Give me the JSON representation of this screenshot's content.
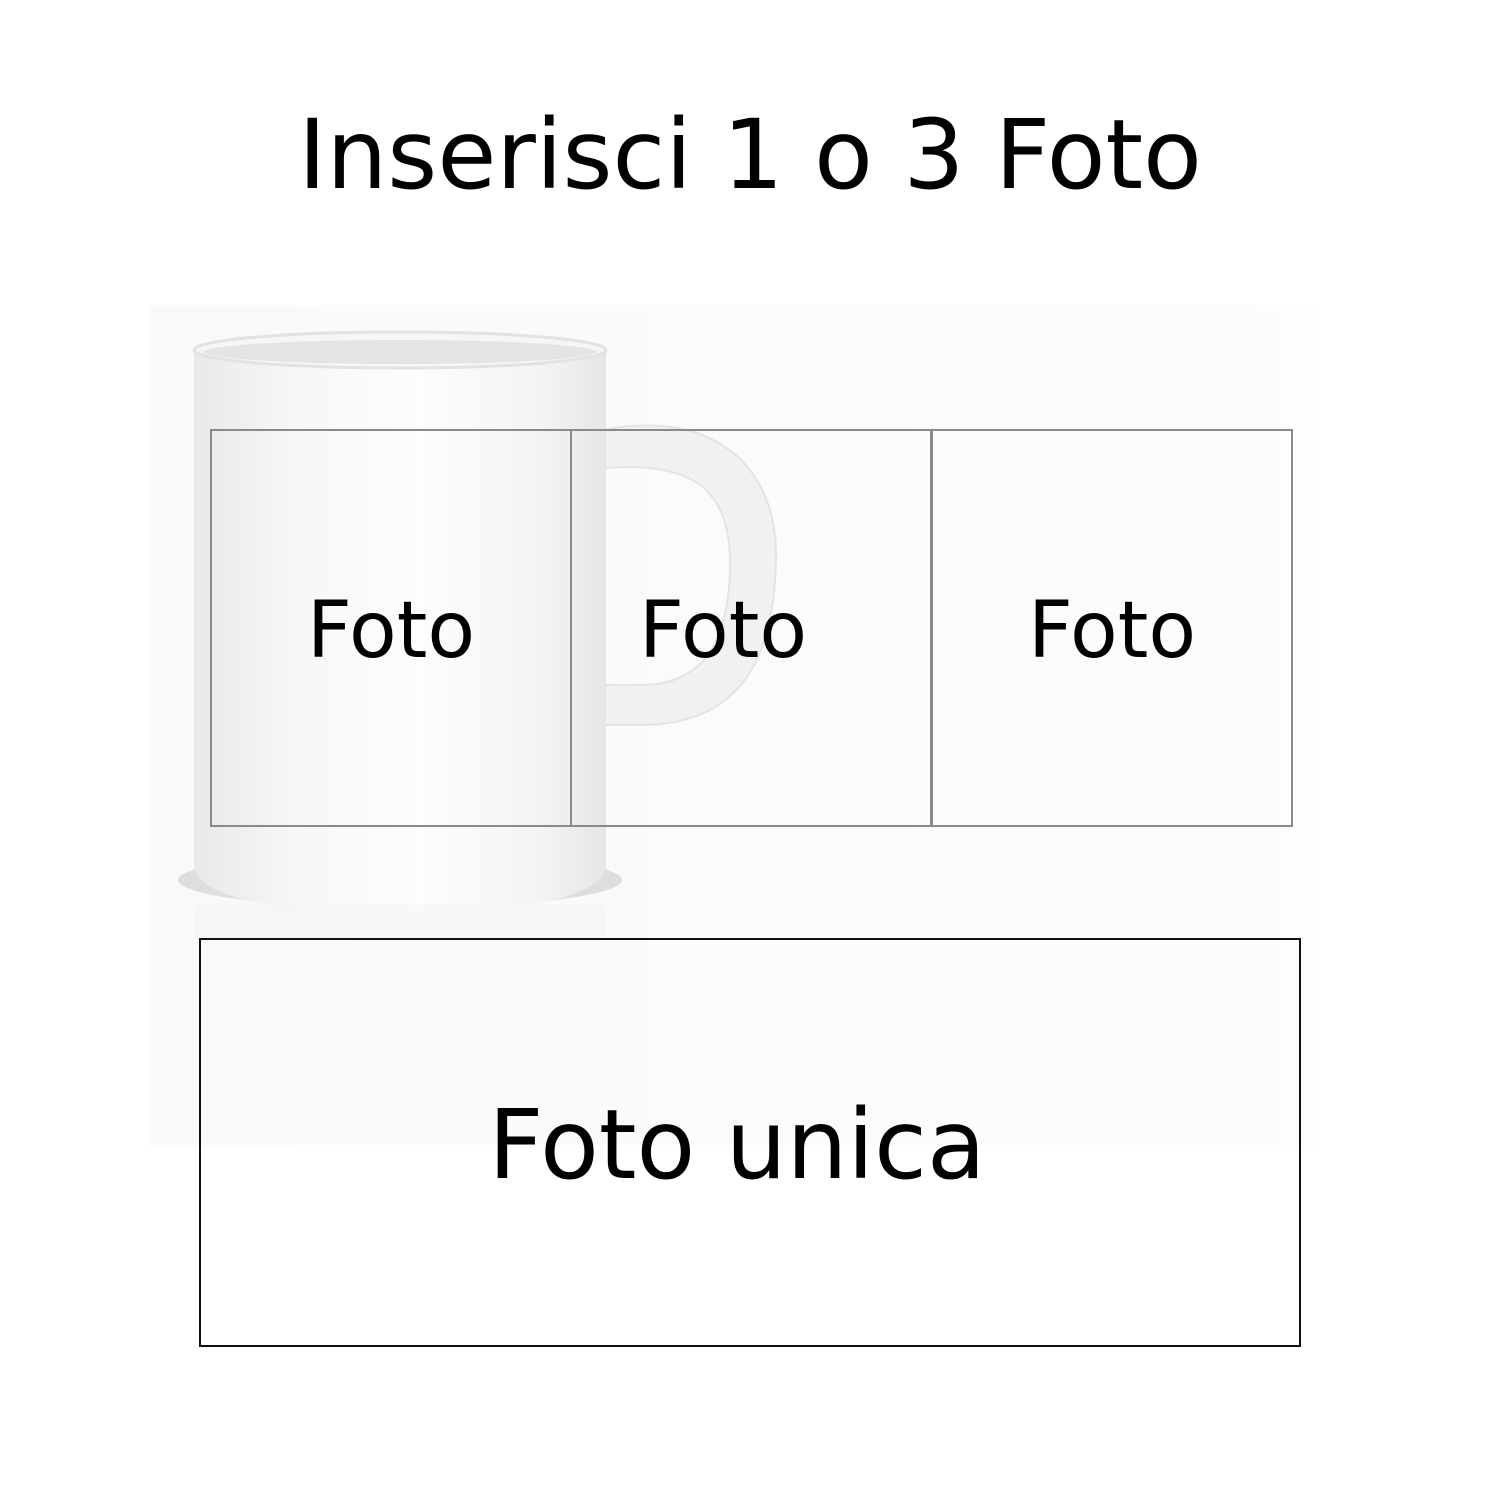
{
  "title": "Inserisci 1 o 3 Foto",
  "three_photo_layout": {
    "slots": [
      "Foto",
      "Foto",
      "Foto"
    ]
  },
  "single_photo_layout": {
    "label": "Foto unica"
  },
  "colors": {
    "background": "#ffffff",
    "text": "#000000",
    "slot_border_small": "#8a8a8a",
    "slot_border_large": "#111111"
  },
  "icons": [
    "white-mug"
  ]
}
